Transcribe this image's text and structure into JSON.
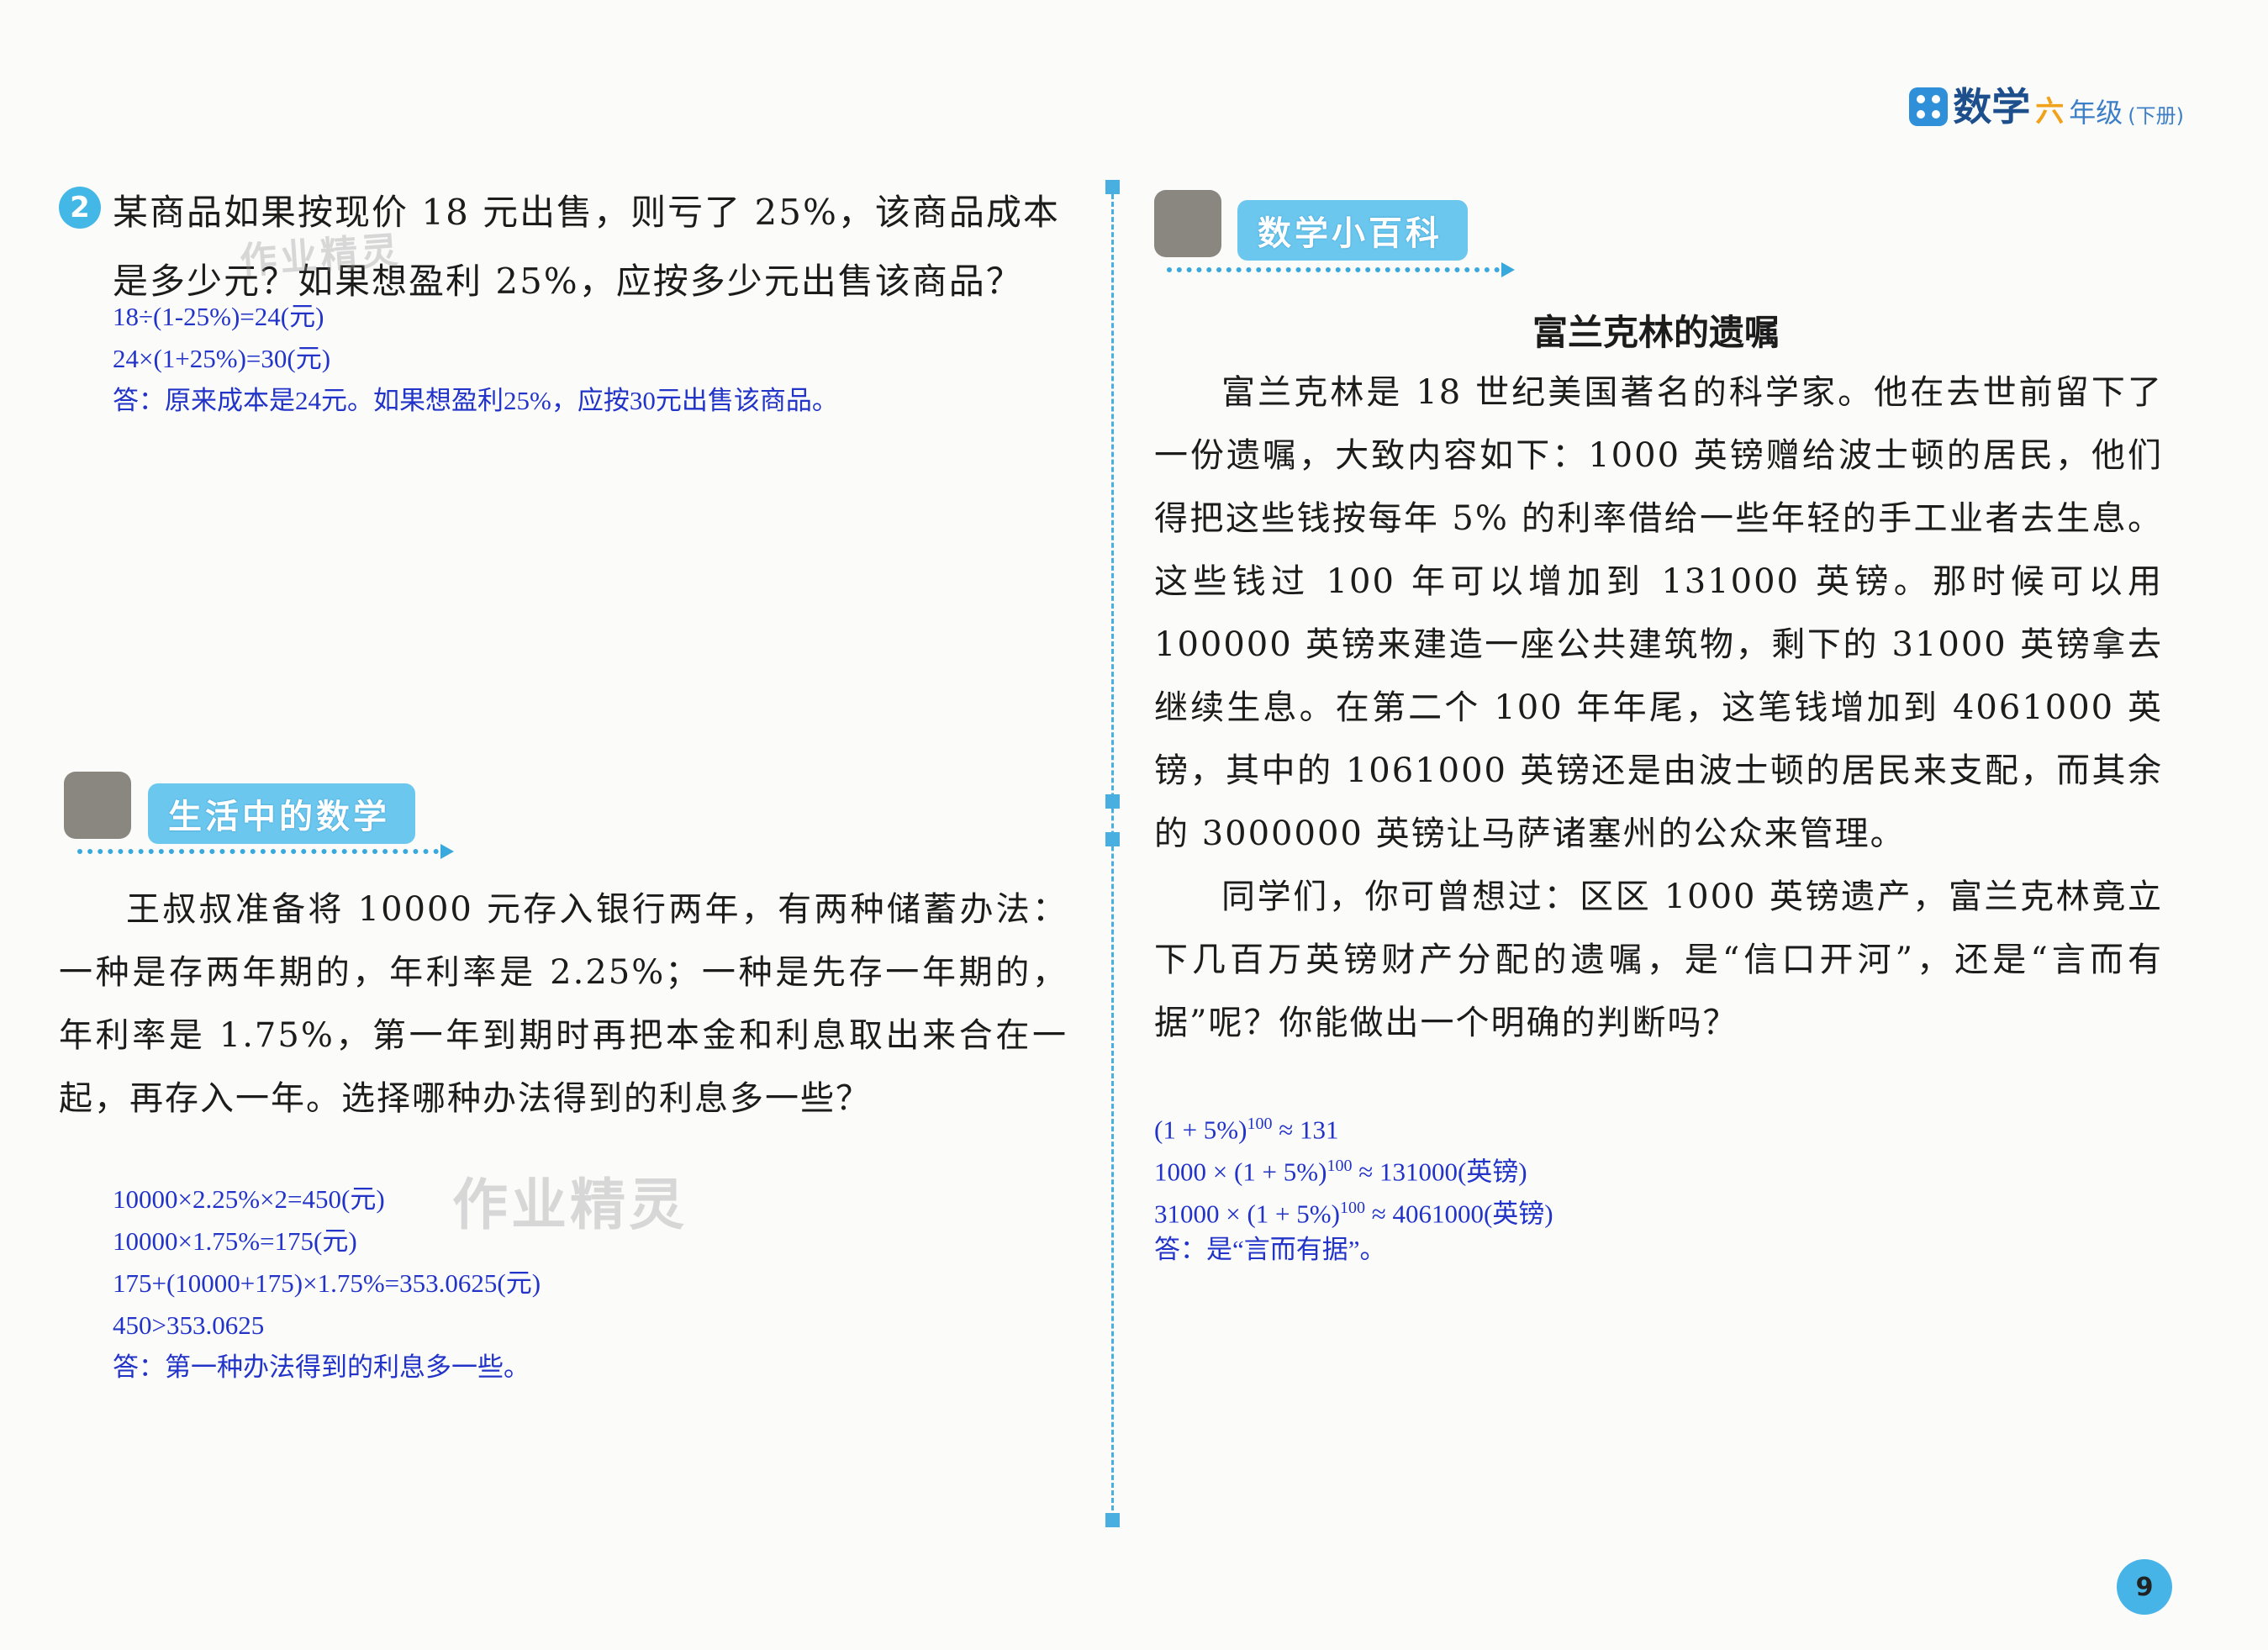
{
  "header": {
    "subject": "数学",
    "grade_mark": "六",
    "grade": "年级",
    "volume": "(下册)"
  },
  "question2": {
    "number": "2",
    "text": "某商品如果按现价 18 元出售，则亏了 25%，该商品成本是多少元？如果想盈利 25%，应按多少元出售该商品？",
    "answer_lines": [
      "18÷(1-25%)=24(元)",
      "24×(1+25%)=30(元)",
      "答：原来成本是24元。如果想盈利25%，应按30元出售该商品。"
    ]
  },
  "life_math": {
    "header": "生活中的数学",
    "text": "王叔叔准备将 10000 元存入银行两年，有两种储蓄办法：一种是存两年期的，年利率是 2.25%；一种是先存一年期的，年利率是 1.75%，第一年到期时再把本金和利息取出来合在一起，再存入一年。选择哪种办法得到的利息多一些？",
    "answer_lines": [
      "10000×2.25%×2=450(元)",
      "10000×1.75%=175(元)",
      "175+(10000+175)×1.75%=353.0625(元)",
      "450>353.0625",
      "答：第一种办法得到的利息多一些。"
    ]
  },
  "encyclopedia": {
    "header": "数学小百科",
    "title": "富兰克林的遗嘱",
    "paragraph1": "富兰克林是 18 世纪美国著名的科学家。他在去世前留下了一份遗嘱，大致内容如下：1000 英镑赠给波士顿的居民，他们得把这些钱按每年 5% 的利率借给一些年轻的手工业者去生息。这些钱过 100 年可以增加到 131000 英镑。那时候可以用 100000 英镑来建造一座公共建筑物，剩下的 31000 英镑拿去继续生息。在第二个 100 年年尾，这笔钱增加到 4061000 英镑，其中的 1061000 英镑还是由波士顿的居民来支配，而其余的 3000000 英镑让马萨诸塞州的公众来管理。",
    "paragraph2": "同学们，你可曾想过：区区 1000 英镑遗产，富兰克林竟立下几百万英镑财产分配的遗嘱，是“信口开河”，还是“言而有据”呢？你能做出一个明确的判断吗？",
    "answer": {
      "l1_pre": "(1 + 5%)",
      "l1_exp": "100",
      "l1_post": " ≈ 131",
      "l2_pre": "1000 × (1 + 5%)",
      "l2_exp": "100",
      "l2_post": " ≈ 131000(英镑)",
      "l3_pre": "31000 × (1 + 5%)",
      "l3_exp": "100",
      "l3_post": " ≈ 4061000(英镑)",
      "l4": "答：是“言而有据”。"
    }
  },
  "watermark": "作业精灵",
  "page_number": "9"
}
